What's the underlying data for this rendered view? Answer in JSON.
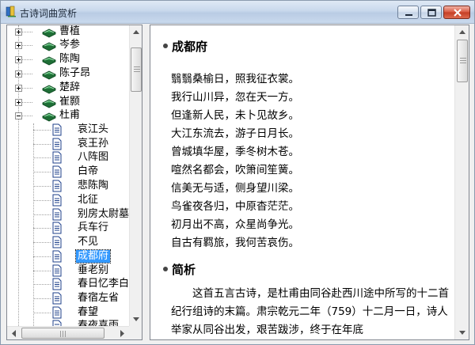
{
  "window": {
    "title": "古诗词曲赏析",
    "minimize_label": "minimize",
    "maximize_label": "maximize",
    "close_label": "close"
  },
  "tree": {
    "poets": [
      {
        "label": "曹植"
      },
      {
        "label": "岑参"
      },
      {
        "label": "陈陶"
      },
      {
        "label": "陈子昂"
      },
      {
        "label": "楚辞"
      },
      {
        "label": "崔颢"
      }
    ],
    "expanded_poet": {
      "label": "杜甫"
    },
    "poems": [
      {
        "label": "哀江头"
      },
      {
        "label": "哀王孙"
      },
      {
        "label": "八阵图"
      },
      {
        "label": "白帝"
      },
      {
        "label": "悲陈陶"
      },
      {
        "label": "北征"
      },
      {
        "label": "别房太尉墓"
      },
      {
        "label": "兵车行"
      },
      {
        "label": "不见"
      },
      {
        "label": "成都府",
        "selected": true
      },
      {
        "label": "垂老别"
      },
      {
        "label": "春日忆李白"
      },
      {
        "label": "春宿左省"
      },
      {
        "label": "春望"
      },
      {
        "label": "春夜喜雨"
      }
    ]
  },
  "content": {
    "poem_title": "成都府",
    "poem_lines": [
      "翳翳桑榆日，照我征衣裳。",
      "我行山川异，忽在天一方。",
      "但逢新人民，未卜见故乡。",
      "大江东流去，游子日月长。",
      "曾城填华屋，季冬树木苍。",
      "喧然名都会，吹箫间笙簧。",
      "信美无与适，侧身望川梁。",
      "鸟雀夜各归，中原杳茫茫。",
      "初月出不高，众星尚争光。",
      "自古有羁旅，我何苦哀伤。"
    ],
    "analysis_heading": "简析",
    "analysis_text": "这首五言古诗，是杜甫由同谷赴西川途中所写的十二首纪行组诗的末篇。肃宗乾元二年（759）十二月一日，诗人举家从同谷出发，艰苦跋涉，终于在年底"
  },
  "colors": {
    "selection": "#3399ff",
    "book_icon": "#1f7a3a",
    "titlebar": "#c8d8ec",
    "close_button": "#c33d24"
  },
  "icons": {
    "app": "app-book-icon",
    "poet": "green-book-icon",
    "poem": "document-icon",
    "bullet": "bullet-icon"
  }
}
